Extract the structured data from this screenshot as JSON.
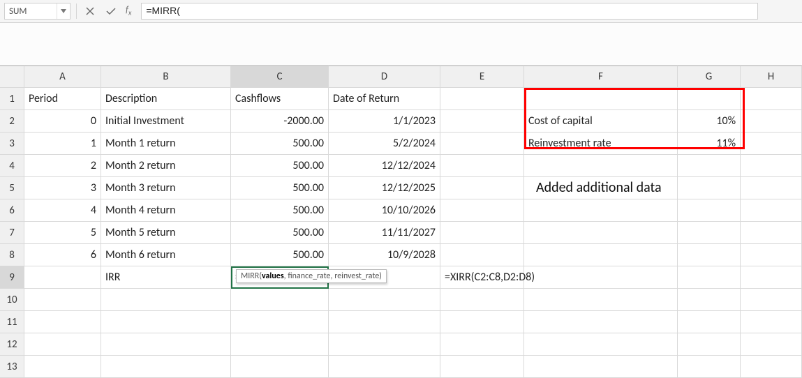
{
  "name_box": "SUM",
  "formula_bar": "=MIRR(",
  "columns": [
    "A",
    "B",
    "C",
    "D",
    "E",
    "F",
    "G",
    "H"
  ],
  "row_count": 13,
  "active_col_index": 3,
  "active_row": 9,
  "headers": {
    "A": "Period",
    "B": "Description",
    "C": "Cashflows",
    "D": "Date of Return"
  },
  "rows": [
    {
      "period": "0",
      "desc": "Initial Investment",
      "cash": "-2000.00",
      "date": "1/1/2023"
    },
    {
      "period": "1",
      "desc": "Month 1 return",
      "cash": "500.00",
      "date": "5/2/2024"
    },
    {
      "period": "2",
      "desc": "Month 2 return",
      "cash": "500.00",
      "date": "12/12/2024"
    },
    {
      "period": "3",
      "desc": "Month 3 return",
      "cash": "500.00",
      "date": "12/12/2025"
    },
    {
      "period": "4",
      "desc": "Month 4 return",
      "cash": "500.00",
      "date": "10/10/2026"
    },
    {
      "period": "5",
      "desc": "Month 5 return",
      "cash": "500.00",
      "date": "11/11/2027"
    },
    {
      "period": "6",
      "desc": "Month 6 return",
      "cash": "500.00",
      "date": "10/9/2028"
    }
  ],
  "row9": {
    "B": "IRR",
    "C": "=MIRR(",
    "E": "=XIRR(C2:C8,D2:D8)"
  },
  "side": {
    "cost_label": "Cost of capital",
    "cost_value": "10%",
    "reinvest_label": "Reinvestment rate",
    "reinvest_value": "11%"
  },
  "annotation": "Added additional data",
  "tooltip": {
    "fn": "MIRR",
    "arg_bold": "values",
    "rest": ", finance_rate, reinvest_rate)"
  }
}
